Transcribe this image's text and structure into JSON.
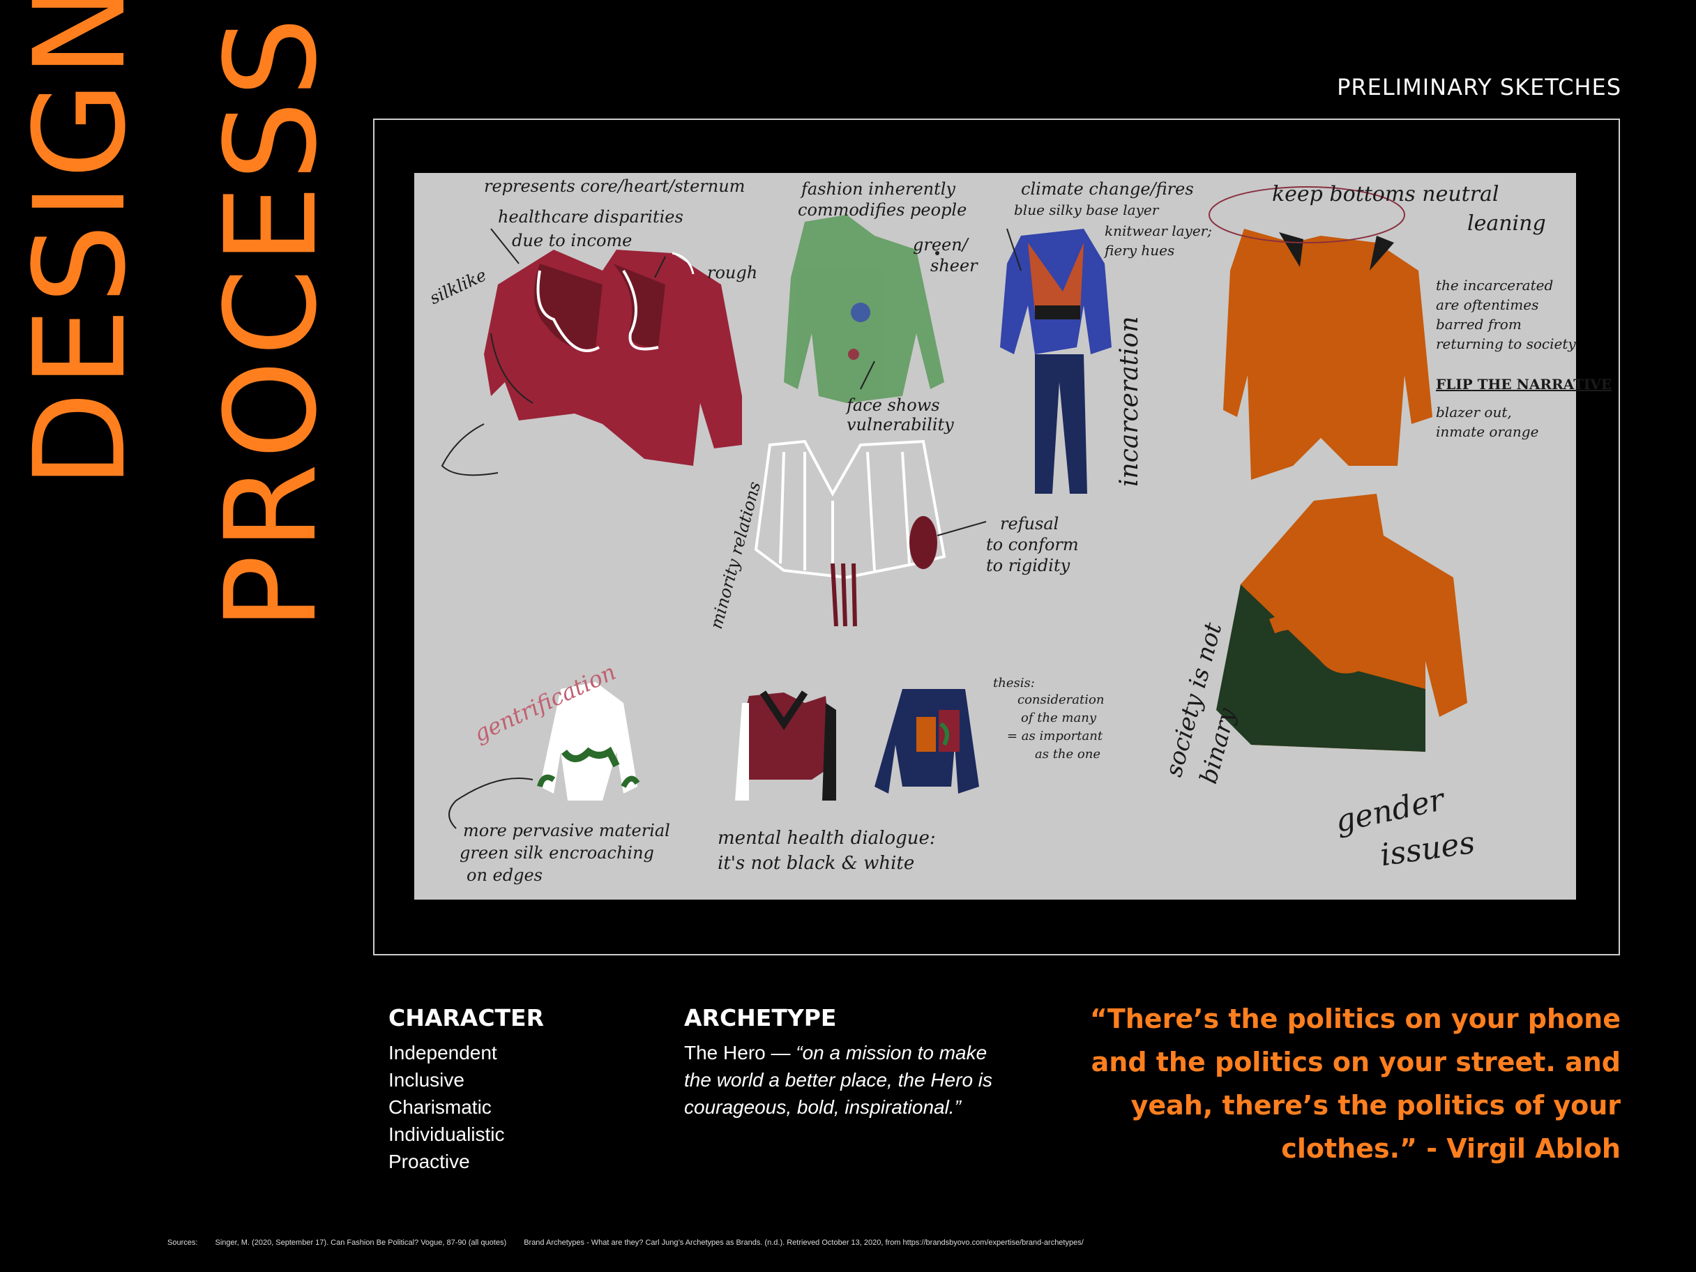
{
  "title": {
    "word1": "DESIGN",
    "word2": "PROCESS"
  },
  "section_label": "PRELIMINARY SKETCHES",
  "sketch_annotations": [
    "represents core/heart/sternum",
    "healthcare disparities",
    "due to income",
    "silklike",
    "rough",
    "fashion inherently",
    "commodifies people",
    "green/",
    "sheer",
    "face shows",
    "vulnerability",
    "climate change/fires",
    "blue silky base layer",
    "knitwear layer;",
    "fiery hues",
    "keep bottoms neutral",
    "leaning",
    "the incarcerated",
    "are oftentimes",
    "barred from",
    "returning to society",
    "FLIP THE NARRATIVE",
    "blazer out,",
    "inmate orange",
    "incarceration",
    "minority relations",
    "refusal",
    "to conform",
    "to rigidity",
    "gentrification",
    "more pervasive material",
    "green silk encroaching",
    "on edges",
    "mental health dialogue:",
    "it's not black & white",
    "thesis:",
    "consideration",
    "of the many",
    "= as important",
    "as the one",
    "society is not",
    "binary",
    "gender",
    "issues"
  ],
  "character": {
    "heading": "CHARACTER",
    "traits": [
      "Independent",
      "Inclusive",
      "Charismatic",
      "Individualistic",
      "Proactive"
    ]
  },
  "archetype": {
    "heading": "ARCHETYPE",
    "name": "The Hero —",
    "description": "“on a mission to make the world a better place, the Hero is courageous, bold, inspirational.”"
  },
  "quote": "“There’s the politics on your phone and the politics on your street. and yeah, there’s the politics of your clothes.” - Virgil Abloh",
  "sources": {
    "label": "Sources:",
    "entries": [
      "Singer, M. (2020, September 17). Can Fashion Be Political? Vogue, 87-90 (all quotes)",
      "Brand Archetypes - What are they? Carl Jung’s Archetypes as Brands. (n.d.). Retrieved October 13, 2020, from https://brandsbyovo.com/expertise/brand-archetypes/"
    ]
  },
  "colors": {
    "background": "#000000",
    "accent": "#ff7f1f",
    "sketch_background": "#c9c9c9",
    "crimson": "#9a2338",
    "burnt_orange": "#c75a0c",
    "forest_green": "#213a22",
    "navy": "#1d2a5c"
  }
}
